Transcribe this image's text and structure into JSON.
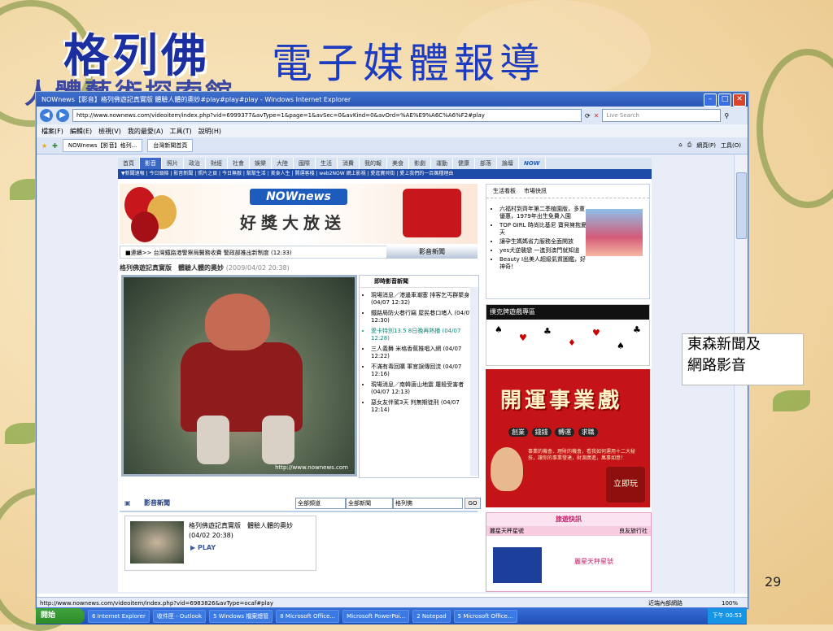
{
  "slide": {
    "logo_text": "格列佛",
    "title": "電子媒體報導",
    "subtitle_partial": "人體藝術探索館",
    "side_note": [
      "東森新聞及",
      "網路影音"
    ],
    "page_number": "29"
  },
  "browser": {
    "window_title": "NOWnews【影音】格列佛遊記真實版 體驗人體的奧妙#play#play#play - Windows Internet Explorer",
    "address": "http://www.nownews.com/videoitem/index.php?vid=6999377&avType=1&page=1&avSec=0&avKind=0&avOrd=%AE%E9%A6C%A6%F2#play",
    "search_placeholder": "Live Search",
    "menu": [
      "檔案(F)",
      "編輯(E)",
      "檢視(V)",
      "我的最愛(A)",
      "工具(T)",
      "說明(H)"
    ],
    "tabs": [
      "NOWnews【影音】格列...",
      "台灣新聞首頁"
    ],
    "tools": [
      "網頁(P)",
      "工具(O)"
    ],
    "status_url": "http://www.nownews.com/videoitem/index.php?vid=6983826&avType=ocaf#play",
    "status_zone": "近端內部網路",
    "zoom": "100%"
  },
  "site": {
    "nav": [
      "首頁",
      "影音",
      "照片",
      "政治",
      "財經",
      "社會",
      "娛樂",
      "大陸",
      "國際",
      "生活",
      "消費",
      "我的報",
      "美食",
      "影劇",
      "運動",
      "健康",
      "部落",
      "論壇",
      "NOW"
    ],
    "nav_active_index": 1,
    "subnav": "▼新聞速報 | 今日頭條 | 影音新聞 | 照片之頁 | 今日無敵 | 幫幫生活 | 美食人生 | 開運客棧 | web2NOW 網上影視 | 愛逛寶貝街 | 愛上我們的一百萬種理由",
    "banner_logo": "NOWnews",
    "banner_text": "好獎大放送",
    "right_tabs": [
      "生活看板",
      "市場快訊"
    ],
    "right_items": [
      "六福村到齊年第二季植園版，多重優惠，1979年出生免費入園",
      "TOP GIRL 時尚比基尼 寶貝擁抱夏天",
      "讓孕生媽媽省力服務全面開放",
      "yes犬逆襲戀 一進到澳門就知道",
      "Beauty I出美人超級氣質圖鑑，好神奇！"
    ],
    "breadcrumb": "■連續>> 台灣鐵路港警察局醫務收費 警政部推出新制度 (12:33)",
    "media_tab": "影音新聞",
    "video_title": "格列佛遊記真實版　體驗人體的奧妙",
    "video_date": "(2009/04/02 20:38)",
    "video_watermark": "http://www.nownews.com",
    "news_head": "即時影音新聞",
    "news_items": [
      {
        "text": "現場消息／港邊車潮塞 排客乞丐群聚身 (04/07 12:32)",
        "hl": false
      },
      {
        "text": "鐵路局防火巷行竊 屋民巷口堵人 (04/07 12:30)",
        "hl": false
      },
      {
        "text": "愛卡特別13.5 8日晚再熱播 (04/07 12:28)",
        "hl": true
      },
      {
        "text": "三人義舞 米格香蕉推唱入網 (04/07 12:22)",
        "hl": false
      },
      {
        "text": "不滿有毒回購 軍官誤傳回流 (04/07 12:16)",
        "hl": false
      },
      {
        "text": "現場消息／南韓唐山地震 屠殺受害者 (04/07 12:13)",
        "hl": false
      },
      {
        "text": "惡女友伴駕3天 判無期徒刑 (04/07 12:14)",
        "hl": false
      }
    ],
    "ad_header": "撲克牌遊戲專區",
    "big_ad_title": "開運事業戲",
    "big_ad_pills": [
      "創業",
      "錢錢",
      "轉運",
      "求職"
    ],
    "big_ad_small": "事業的機會、理財的機會，看我如何運用十二大秘技，讓你的事業發達，財源廣進，萬事如意！",
    "big_ad_button": "立即玩",
    "travel_head": "旅遊快訊",
    "travel_row_left": "麗星天秤星號",
    "travel_row_right": "良友旅行社",
    "travel_name": "麗星天秤星號",
    "media_section_label": "影音新聞",
    "select_1": "全部頻道",
    "select_2": "全部新聞",
    "search_value": "格列佛",
    "go_label": "GO",
    "thumb_title": "格列佛遊記真實版　體驗人體的奧妙 (04/02 20:38)",
    "play_label": "PLAY"
  },
  "taskbar": {
    "start": "開始",
    "items": [
      "6 Internet Explorer",
      "收件匣 - Outlook",
      "5 Windows 檔案總管",
      "8 Microsoft Office...",
      "Microsoft PowerPoi...",
      "2 Notepad",
      "5 Microsoft Office..."
    ],
    "clock": "下午 00:53"
  }
}
